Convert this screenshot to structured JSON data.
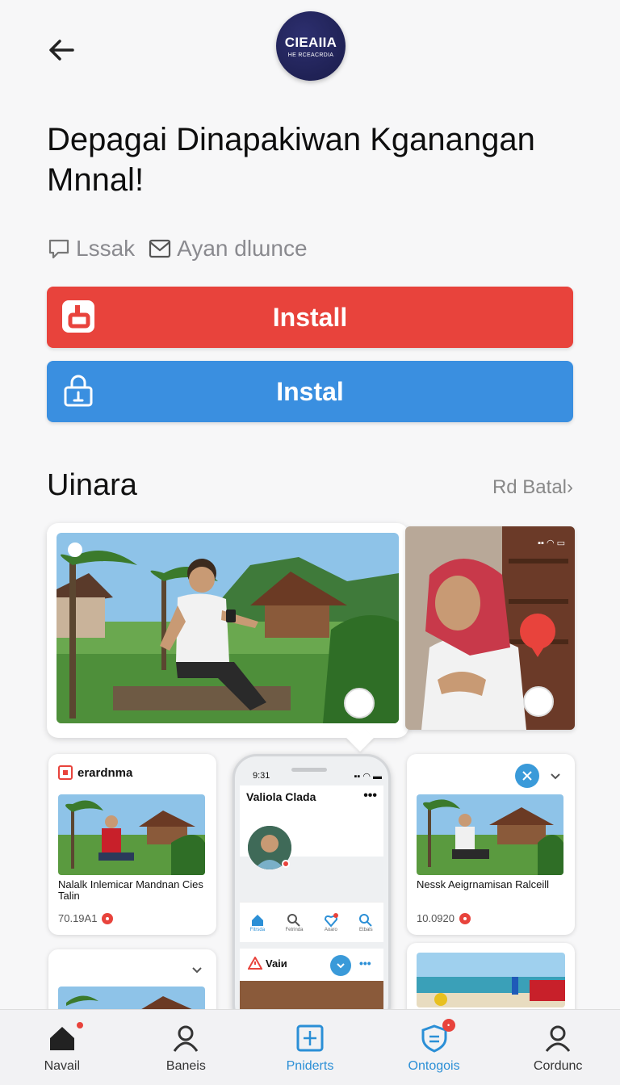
{
  "header": {
    "logo_line1": "CIEAIIA",
    "logo_line2": "HE RCEACRDIA"
  },
  "title": "Depagai Dinapakiwan Kganangan Mnnal!",
  "meta": {
    "comments_label": "Lssak",
    "mail_label": "Ayan dlɯnce"
  },
  "buttons": {
    "install_red": "Install",
    "install_blue": "Instal"
  },
  "section": {
    "title": "Uinara",
    "see_all": "Rd Batal›"
  },
  "cards": [
    {
      "head": "erardnma",
      "caption": "Nalalk Inlemicar Mandnan Cies Talin",
      "number": "70.19A1"
    },
    {
      "head": "",
      "caption": "Nessk Aeigrnamisan Ralceill",
      "number": "10.0920"
    }
  ],
  "phone": {
    "time": "9:31",
    "title": "Valiola Clada",
    "more": "•••",
    "row_label": "Vaiи",
    "tabs": [
      "Fitrsda",
      "Fetrinda",
      "Aoaro",
      "Etbals"
    ]
  },
  "bottom_nav": [
    {
      "label": "Navail",
      "icon": "home-icon"
    },
    {
      "label": "Baneis",
      "icon": "person-icon"
    },
    {
      "label": "Pniderts",
      "icon": "compose-icon"
    },
    {
      "label": "Ontogois",
      "icon": "shield-icon"
    },
    {
      "label": "Cordunc",
      "icon": "profile-icon"
    }
  ],
  "colors": {
    "red": "#e8433c",
    "blue": "#3a8fe0",
    "nav_active": "#2b8fd6",
    "logo": "#1f2157"
  }
}
